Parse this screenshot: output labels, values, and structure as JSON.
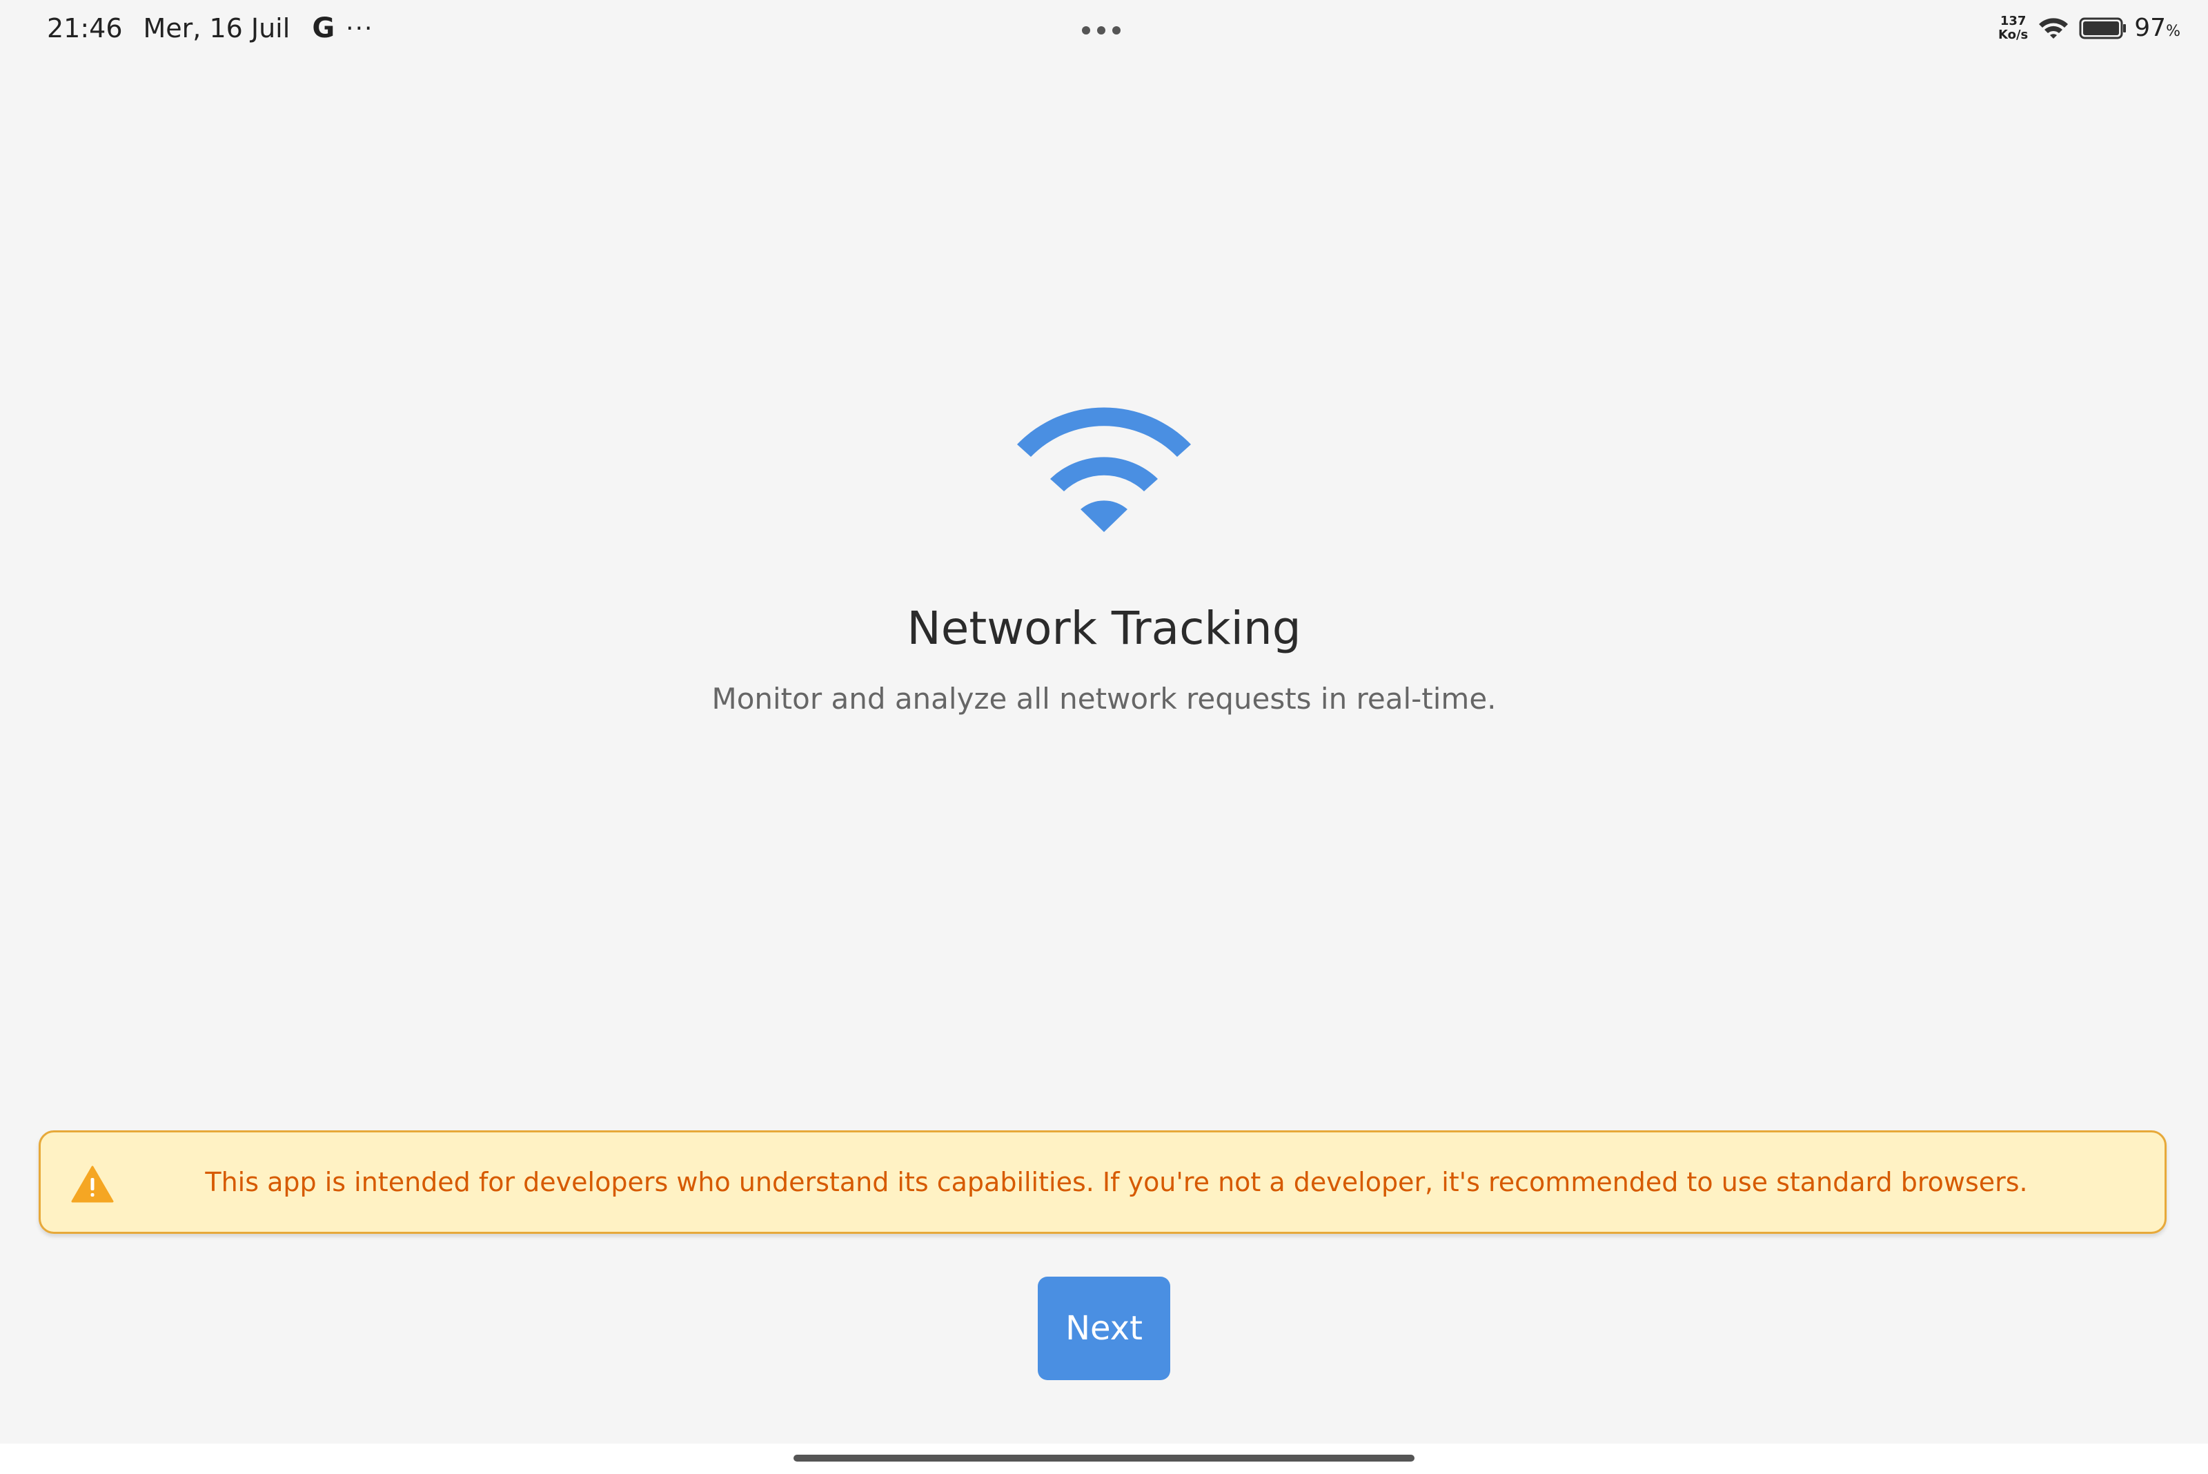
{
  "status_bar": {
    "time": "21:46",
    "date": "Mer, 16 Juil",
    "g_label": "G",
    "more": "···",
    "net_speed_value": "137",
    "net_speed_unit": "Ko/s",
    "battery_percent": "97",
    "battery_percent_sign": "%"
  },
  "main": {
    "icon": "wifi-icon",
    "icon_color": "#4a8fe2",
    "title": "Network Tracking",
    "subtitle": "Monitor and analyze all network requests in real-time."
  },
  "warning": {
    "icon": "warning-triangle-icon",
    "icon_color": "#f5a623",
    "text": "This app is intended for developers who understand its capabilities. If you're not a developer, it's recommended to use standard browsers.",
    "text_color": "#d65a00",
    "background": "#fff2c4",
    "border_color": "#e7a93a"
  },
  "actions": {
    "next_label": "Next",
    "next_color": "#4a8fe2"
  }
}
